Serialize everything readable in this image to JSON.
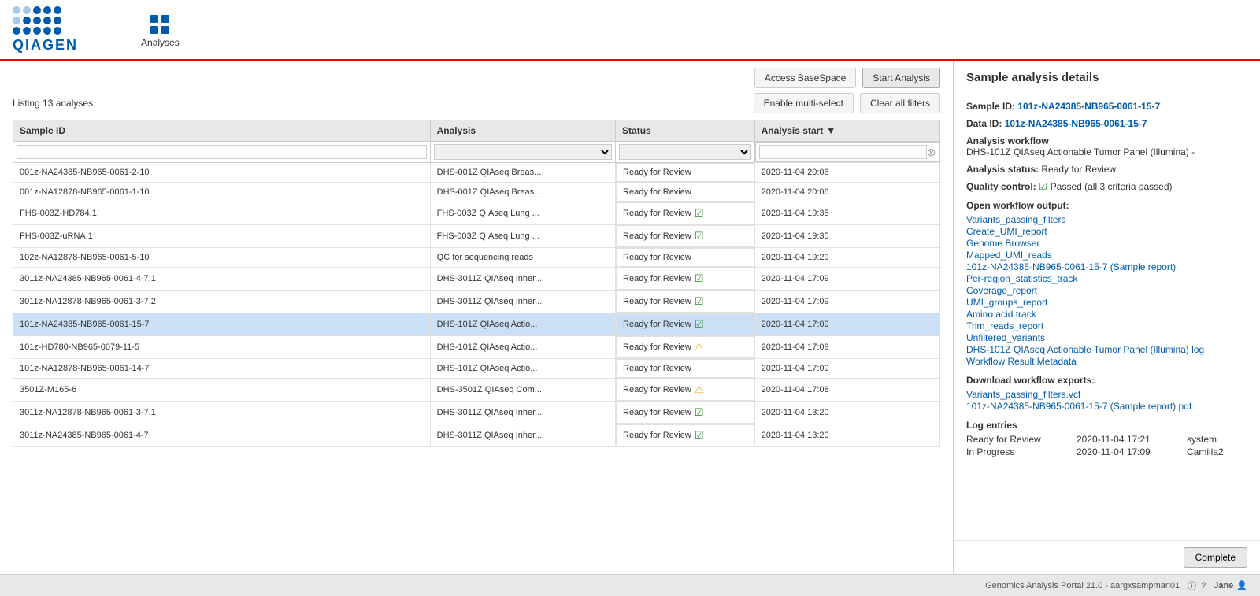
{
  "header": {
    "logo_text": "QIAGEN",
    "nav_label": "Analyses"
  },
  "toolbar": {
    "access_basespace": "Access BaseSpace",
    "start_analysis": "Start Analysis",
    "enable_multiselect": "Enable multi-select",
    "clear_filters": "Clear all filters",
    "listing_text": "Listing 13 analyses"
  },
  "table": {
    "columns": [
      "Sample ID",
      "Analysis",
      "Status",
      "Analysis start"
    ],
    "filter_placeholders": [
      "",
      "",
      "",
      ""
    ],
    "rows": [
      {
        "id": "001z-NA24385-NB965-0061-2-10",
        "analysis": "DHS-001Z QIAseq Breas...",
        "status": "Ready for Review",
        "status_icon": "",
        "date": "2020-11-04 20:06",
        "selected": false
      },
      {
        "id": "001z-NA12878-NB965-0061-1-10",
        "analysis": "DHS-001Z QIAseq Breas...",
        "status": "Ready for Review",
        "status_icon": "",
        "date": "2020-11-04 20:06",
        "selected": false
      },
      {
        "id": "FHS-003Z-HD784.1",
        "analysis": "FHS-003Z QIAseq Lung ...",
        "status": "Ready for Review",
        "status_icon": "check",
        "date": "2020-11-04 19:35",
        "selected": false
      },
      {
        "id": "FHS-003Z-uRNA.1",
        "analysis": "FHS-003Z QIAseq Lung ...",
        "status": "Ready for Review",
        "status_icon": "check",
        "date": "2020-11-04 19:35",
        "selected": false
      },
      {
        "id": "102z-NA12878-NB965-0061-5-10",
        "analysis": "QC for sequencing reads",
        "status": "Ready for Review",
        "status_icon": "",
        "date": "2020-11-04 19:29",
        "selected": false
      },
      {
        "id": "3011z-NA24385-NB965-0061-4-7.1",
        "analysis": "DHS-3011Z QIAseq Inher...",
        "status": "Ready for Review",
        "status_icon": "check",
        "date": "2020-11-04 17:09",
        "selected": false
      },
      {
        "id": "3011z-NA12878-NB965-0061-3-7.2",
        "analysis": "DHS-3011Z QIAseq Inher...",
        "status": "Ready for Review",
        "status_icon": "check",
        "date": "2020-11-04 17:09",
        "selected": false
      },
      {
        "id": "101z-NA24385-NB965-0061-15-7",
        "analysis": "DHS-101Z QIAseq Actio...",
        "status": "Ready for Review",
        "status_icon": "check",
        "date": "2020-11-04 17:09",
        "selected": true
      },
      {
        "id": "101z-HD780-NB965-0079-11-5",
        "analysis": "DHS-101Z QIAseq Actio...",
        "status": "Ready for Review",
        "status_icon": "warn",
        "date": "2020-11-04 17:09",
        "selected": false
      },
      {
        "id": "101z-NA12878-NB965-0061-14-7",
        "analysis": "DHS-101Z QIAseq Actio...",
        "status": "Ready for Review",
        "status_icon": "",
        "date": "2020-11-04 17:09",
        "selected": false
      },
      {
        "id": "3501Z-M165-6",
        "analysis": "DHS-3501Z QIAseq Com...",
        "status": "Ready for Review",
        "status_icon": "warn",
        "date": "2020-11-04 17:08",
        "selected": false
      },
      {
        "id": "3011z-NA12878-NB965-0061-3-7.1",
        "analysis": "DHS-3011Z QIAseq Inher...",
        "status": "Ready for Review",
        "status_icon": "check",
        "date": "2020-11-04 13:20",
        "selected": false
      },
      {
        "id": "3011z-NA24385-NB965-0061-4-7",
        "analysis": "DHS-3011Z QIAseq Inher...",
        "status": "Ready for Review",
        "status_icon": "check",
        "date": "2020-11-04 13:20",
        "selected": false
      }
    ]
  },
  "detail_panel": {
    "title": "Sample analysis details",
    "sample_id_label": "Sample ID:",
    "sample_id_value": "101z-NA24385-NB965-0061-15-7",
    "data_id_label": "Data ID:",
    "data_id_value": "101z-NA24385-NB965-0061-15-7",
    "workflow_label": "Analysis workflow",
    "workflow_value": "DHS-101Z QIAseq Actionable Tumor Panel (Illumina) -",
    "status_label": "Analysis status:",
    "status_value": "Ready for Review",
    "qc_label": "Quality control:",
    "qc_value": "Passed (all 3 criteria passed)",
    "open_workflow_label": "Open workflow output:",
    "workflow_links": [
      "Variants_passing_filters",
      "Create_UMI_report",
      "Genome Browser",
      "Mapped_UMI_reads",
      "101z-NA24385-NB965-0061-15-7 (Sample report)",
      "Per-region_statistics_track",
      "Coverage_report",
      "UMI_groups_report",
      "Amino acid track",
      "Trim_reads_report",
      "Unfiltered_variants",
      "DHS-101Z QIAseq Actionable Tumor Panel (Illumina) log",
      "Workflow Result Metadata"
    ],
    "download_label": "Download workflow exports:",
    "download_links": [
      "Variants_passing_filters.vcf",
      "101z-NA24385-NB965-0061-15-7 (Sample report).pdf"
    ],
    "log_label": "Log entries",
    "log_entries": [
      {
        "status": "Ready for Review",
        "date": "2020-11-04 17:21",
        "user": "system"
      },
      {
        "status": "In Progress",
        "date": "2020-11-04 17:09",
        "user": "Camilla2"
      }
    ],
    "complete_button": "Complete"
  },
  "footer": {
    "text": "Genomics Analysis Portal 21.0 - aargxsampman01",
    "user": "Jane"
  }
}
